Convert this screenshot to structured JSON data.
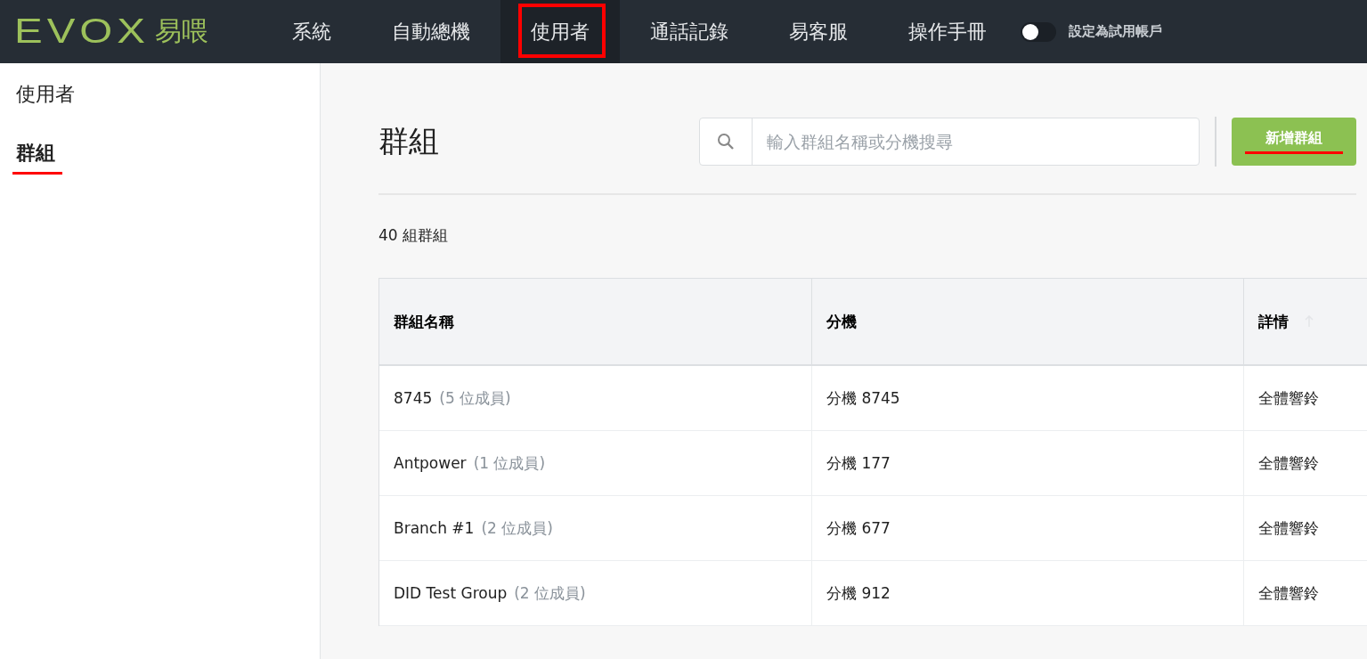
{
  "logo": {
    "mark": "EVOX",
    "name": "易喂"
  },
  "nav": [
    {
      "label": "系統",
      "selected": false,
      "highlighted": false
    },
    {
      "label": "自動總機",
      "selected": false,
      "highlighted": false
    },
    {
      "label": "使用者",
      "selected": true,
      "highlighted": true
    },
    {
      "label": "通話記錄",
      "selected": false,
      "highlighted": false
    },
    {
      "label": "易客服",
      "selected": false,
      "highlighted": false
    },
    {
      "label": "操作手冊",
      "selected": false,
      "highlighted": false
    }
  ],
  "trial_toggle": {
    "label": "設定為試用帳戶",
    "on": false
  },
  "sidebar": {
    "items": [
      {
        "label": "使用者",
        "selected": false,
        "highlighted": false
      },
      {
        "label": "群組",
        "selected": true,
        "highlighted": true
      }
    ]
  },
  "page": {
    "title": "群組",
    "search": {
      "placeholder": "輸入群組名稱或分機搜尋"
    },
    "add_button": {
      "label": "新增群組",
      "highlighted": true
    },
    "count": "40 組群組"
  },
  "table": {
    "columns": [
      "群組名稱",
      "分機",
      "詳情"
    ],
    "rows": [
      {
        "name": "8745",
        "members": "(5 位成員)",
        "extension": "分機 8745",
        "detail": "全體響鈴"
      },
      {
        "name": "Antpower",
        "members": "(1 位成員)",
        "extension": "分機 177",
        "detail": "全體響鈴"
      },
      {
        "name": "Branch #1",
        "members": "(2 位成員)",
        "extension": "分機 677",
        "detail": "全體響鈴"
      },
      {
        "name": "DID Test Group",
        "members": "(2 位成員)",
        "extension": "分機 912",
        "detail": "全體響鈴"
      }
    ]
  }
}
